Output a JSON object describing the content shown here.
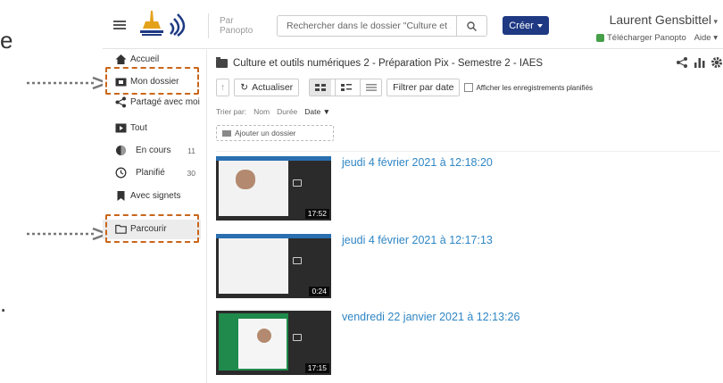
{
  "fragments": {
    "top_letter": "e",
    "bottom_mark": "."
  },
  "header": {
    "par_line1": "Par",
    "par_line2": "Panopto",
    "search_placeholder": "Rechercher dans le dossier \"Culture et ...",
    "create_label": "Créer",
    "user_name": "Laurent Gensbittel",
    "download_label": "Télécharger Panopto",
    "help_label": "Aide"
  },
  "sidebar": {
    "items": [
      {
        "label": "Accueil",
        "icon": "home-icon"
      },
      {
        "label": "Mon dossier",
        "icon": "my-folder-icon"
      },
      {
        "label": "Partagé avec moi",
        "icon": "share-icon"
      },
      {
        "label": "Tout",
        "icon": "video-icon"
      },
      {
        "label": "En cours",
        "icon": "in-progress-icon",
        "count": "11"
      },
      {
        "label": "Planifié",
        "icon": "clock-icon",
        "count": "30"
      },
      {
        "label": "Avec signets",
        "icon": "bookmark-icon"
      },
      {
        "label": "Parcourir",
        "icon": "folder-outline-icon"
      }
    ]
  },
  "content": {
    "breadcrumb": "Culture et outils numériques 2 - Préparation Pix - Semestre 2 - IAES",
    "refresh_label": "Actualiser",
    "filter_label": "Filtrer par date",
    "show_scheduled_label": "Afficher les enregistrements planifiés",
    "sort": {
      "label": "Trier par:",
      "name": "Nom",
      "duration": "Durée",
      "date": "Date"
    },
    "add_folder_label": "Ajouter un dossier",
    "sessions": [
      {
        "title": "jeudi 4 février 2021 à 12:18:20",
        "duration": "17:52"
      },
      {
        "title": "jeudi 4 février 2021 à 12:17:13",
        "duration": "0:24"
      },
      {
        "title": "vendredi 22 janvier 2021 à 12:13:26",
        "duration": "17:15"
      }
    ]
  },
  "colors": {
    "accent": "#1f3a83",
    "link": "#2f86c4",
    "highlight": "#c9661a"
  }
}
